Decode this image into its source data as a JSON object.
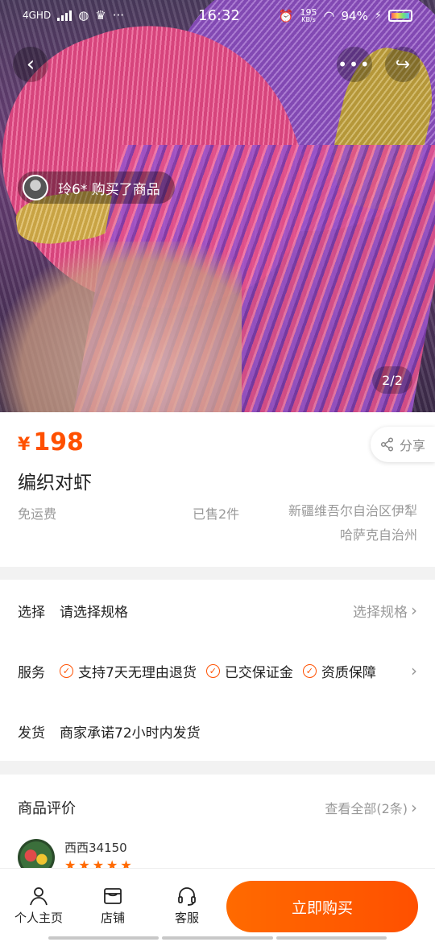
{
  "status_bar": {
    "network": "4GHD",
    "time": "16:32",
    "speed_value": "195",
    "speed_unit": "KB/s",
    "battery_pct": "94%"
  },
  "gallery": {
    "buyer_notice": "玲6* 购买了商品",
    "counter": "2/2"
  },
  "product": {
    "currency": "¥",
    "price": "198",
    "share_label": "分享",
    "title": "编织对虾",
    "shipping": "免运费",
    "sold": "已售2件",
    "location": "新疆维吾尔自治区伊犁哈萨克自治州"
  },
  "spec": {
    "select_label": "选择",
    "select_value": "请选择规格",
    "select_action": "选择规格",
    "service_label": "服务",
    "services": [
      "支持7天无理由退货",
      "已交保证金",
      "资质保障"
    ],
    "delivery_label": "发货",
    "delivery_value": "商家承诺72小时内发货"
  },
  "reviews": {
    "title": "商品评价",
    "view_all": "查看全部(2条)",
    "first_user": "西西34150",
    "first_rating": 5
  },
  "bottom_bar": {
    "tabs": [
      "个人主页",
      "店铺",
      "客服"
    ],
    "buy_label": "立即购买"
  },
  "colors": {
    "accent": "#ff5000",
    "muted": "#999999"
  }
}
